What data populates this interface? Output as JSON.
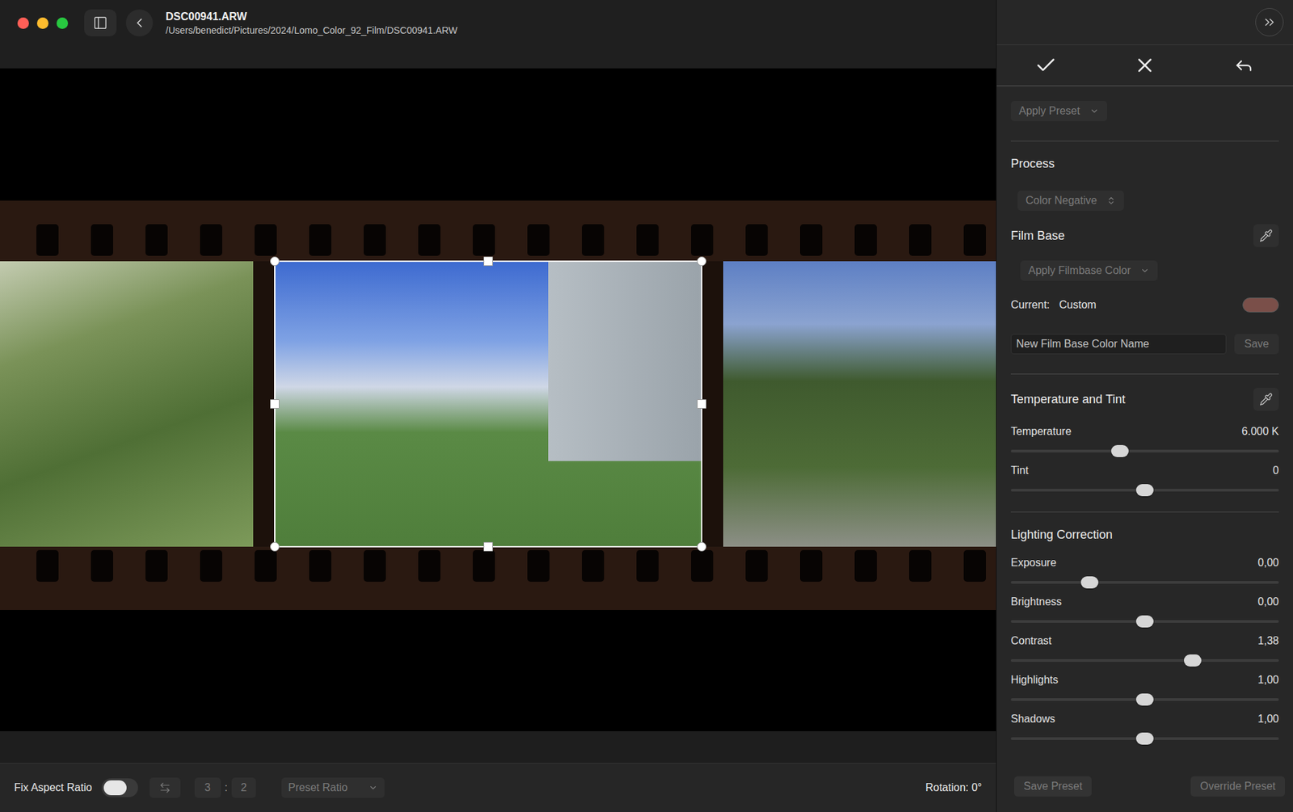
{
  "window": {
    "title": "DSC00941.ARW",
    "path": "/Users/benedict/Pictures/2024/Lomo_Color_92_Film/DSC00941.ARW"
  },
  "canvas": {
    "frames": [
      {
        "selected": false
      },
      {
        "selected": true
      },
      {
        "selected": false
      }
    ]
  },
  "toolbar": {
    "fix_aspect_ratio": {
      "label": "Fix Aspect Ratio",
      "on": false
    },
    "swap": {
      "disabled": true
    },
    "ratio": {
      "width": "3",
      "separator": ":",
      "height": "2",
      "disabled": true
    },
    "preset_ratio": {
      "label": "Preset Ratio",
      "disabled": true
    },
    "rotation": "Rotation: 0°"
  },
  "panel": {
    "apply_preset": {
      "label": "Apply Preset",
      "disabled": true
    },
    "process": {
      "title": "Process",
      "value": "Color Negative",
      "disabled": true
    },
    "film_base": {
      "title": "Film Base",
      "apply": {
        "label": "Apply Filmbase Color",
        "disabled": true
      },
      "current_label": "Current:",
      "current_value": "Custom",
      "color": "#7a4f49",
      "name_placeholder": "New Film Base Color Name",
      "save": {
        "label": "Save",
        "disabled": true
      }
    },
    "temperature_tint": {
      "title": "Temperature and Tint",
      "sliders": [
        {
          "label": "Temperature",
          "value": "6.000 K",
          "level": 0.4
        },
        {
          "label": "Tint",
          "value": "0",
          "level": 0.5
        }
      ]
    },
    "lighting": {
      "title": "Lighting Correction",
      "sliders": [
        {
          "label": "Exposure",
          "value": "0,00",
          "level": 0.28
        },
        {
          "label": "Brightness",
          "value": "0,00",
          "level": 0.5
        },
        {
          "label": "Contrast",
          "value": "1,38",
          "level": 0.69
        },
        {
          "label": "Highlights",
          "value": "1,00",
          "level": 0.5
        },
        {
          "label": "Shadows",
          "value": "1,00",
          "level": 0.5
        }
      ]
    },
    "footer": [
      {
        "label": "Save Preset",
        "disabled": true
      },
      {
        "label": "Override Preset",
        "disabled": true
      }
    ]
  }
}
